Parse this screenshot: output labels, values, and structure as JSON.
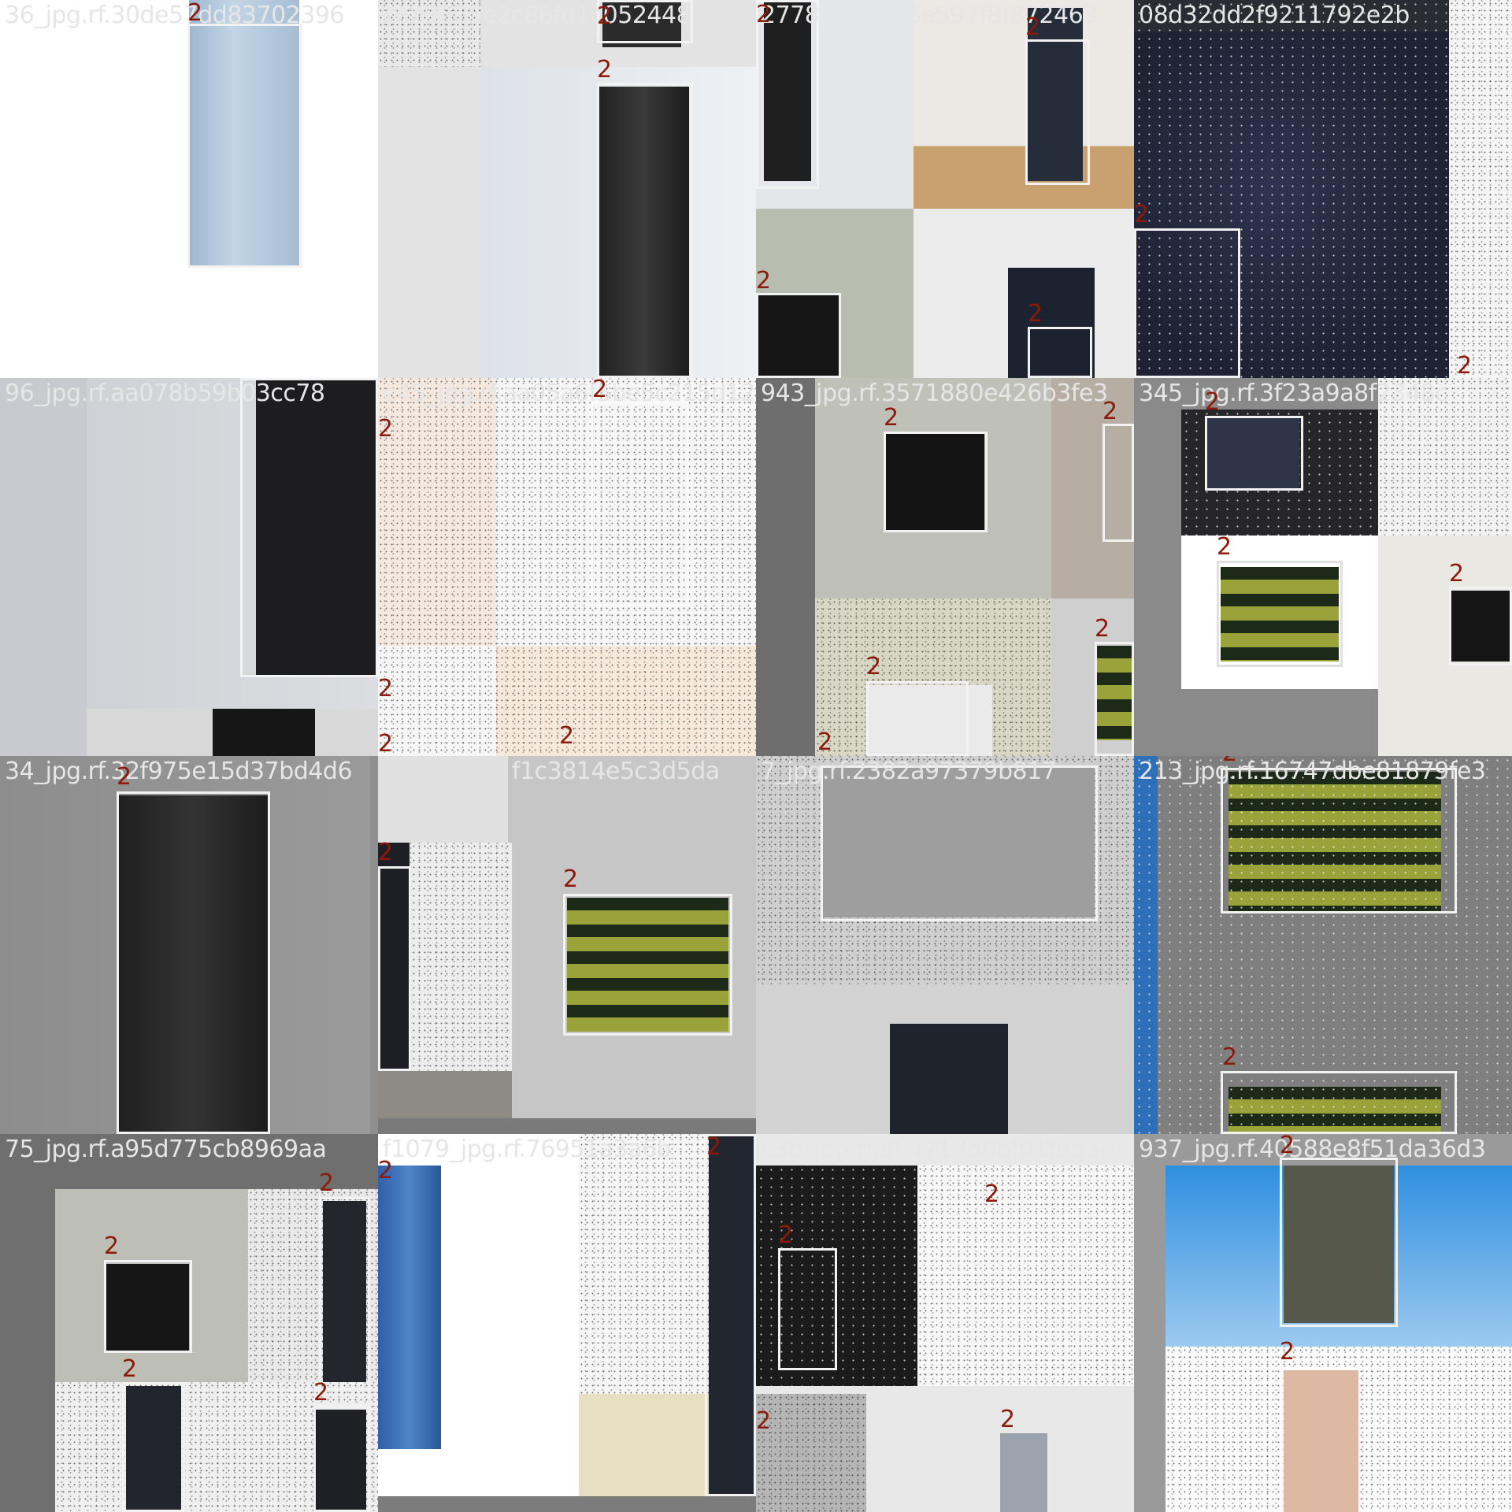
{
  "tiles": [
    {
      "caption": "36_jpg.rf.30de57dd83702396",
      "label": "2"
    },
    {
      "caption": "cab9005e2c86fd1c052448",
      "label": "2"
    },
    {
      "caption": "277898e6256e597f8f872463",
      "label": "2"
    },
    {
      "caption": "08d32dd2f9211792e2b",
      "label": "2"
    },
    {
      "caption": "96_jpg.rf.aa078b59b03cc78",
      "label": "2"
    },
    {
      "caption": "e45_jpg.rf.aa05a6f5be5c215d12f",
      "label": "2"
    },
    {
      "caption": "943_jpg.rf.3571880e426b3fe3",
      "label": "2"
    },
    {
      "caption": "345_jpg.rf.3f23a9a8f2348c",
      "label": "2"
    },
    {
      "caption": "34_jpg.rf.32f975e15d37bd4d6",
      "label": "2"
    },
    {
      "caption": "f1c3814e5c3d5da",
      "label": "2"
    },
    {
      "caption": "7_jpg.rf.2382a97379b817",
      "label": "2"
    },
    {
      "caption": "213_jpg.rf.16747dbe81879fe3",
      "label": "2"
    },
    {
      "caption": "75_jpg.rf.a95d775cb8969aa",
      "label": "2"
    },
    {
      "caption": "f1079_jpg.rf.76951a3a6b",
      "label": "2"
    },
    {
      "caption": "c36_jpg.rf.864213d0bf01fb5a6",
      "label": "2"
    },
    {
      "caption": "937_jpg.rf.40588e8f51da36d3",
      "label": "2"
    }
  ]
}
